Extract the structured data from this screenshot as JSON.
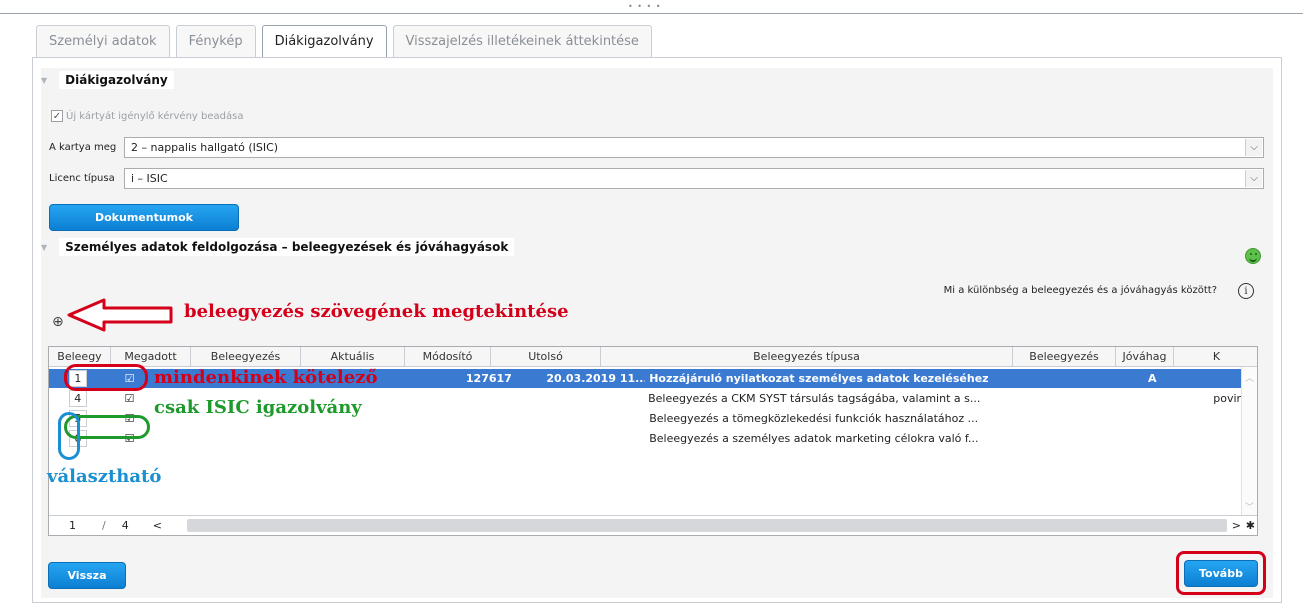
{
  "tabs": [
    {
      "label": "Személyi adatok"
    },
    {
      "label": "Fénykép"
    },
    {
      "label": "Diákigazolvány"
    },
    {
      "label": "Visszajelzés illetékeinek áttekintése"
    }
  ],
  "section1": {
    "title": "Diákigazolvány",
    "checkbox_label": "Új kártyát igénylő kérvény beadása",
    "card_type": {
      "label": "A kartya meg",
      "value": "2 – nappalis hallgató (ISIC)"
    },
    "license_type": {
      "label": "Licenc típusa",
      "value": "i – ISIC"
    },
    "documents_button": "Dokumentumok"
  },
  "section2": {
    "title": "Személyes adatok feldolgozása – beleegyezések és jóváhagyások",
    "help_text": "Mi a különbség a beleegyezés és a jóváhagyás között?",
    "info_icon": "i"
  },
  "annotations": {
    "view_text": "beleegyezés szövegének megtekintése",
    "mandatory": "mindenkinek kötelező",
    "isic_only": "csak ISIC igazolvány",
    "optional": "választható"
  },
  "table": {
    "headers": [
      "Beleegy",
      "Megadott",
      "Beleegyezés",
      "Aktuális",
      "Módosító",
      "Utolsó",
      "Beleegyezés típusa",
      "Beleegyezés",
      "Jóváhag",
      "K"
    ],
    "rows": [
      {
        "num": "1",
        "checked": "☑",
        "modifier": "127617",
        "last": "20.03.2019 11...",
        "type": "Hozzájáruló nyilatkozat személyes adatok kezeléséhez",
        "approval": "A",
        "k": ""
      },
      {
        "num": "4",
        "checked": "☑",
        "modifier": "",
        "last": "",
        "type": "Beleegyezés a CKM SYST társulás tagságába, valamint a s...",
        "approval": "",
        "k": "povir"
      },
      {
        "num": "5",
        "checked": "☑",
        "modifier": "",
        "last": "",
        "type": "Beleegyezés a tömegközlekedési funkciók használatához ...",
        "approval": "",
        "k": ""
      },
      {
        "num": "6",
        "checked": "☑",
        "modifier": "",
        "last": "",
        "type": "Beleegyezés a személyes adatok marketing célokra való f...",
        "approval": "",
        "k": ""
      }
    ],
    "pager": {
      "page": "1",
      "sep": "/",
      "total": "4",
      "prev": "<",
      "next": ">",
      "settings": "✱"
    }
  },
  "footer": {
    "back_button": "Vissza",
    "next_button": "Tovább"
  },
  "colors": {
    "accent": "#0c7fd2",
    "selected_row": "#3a7ad1",
    "annot_red": "#d4001a",
    "annot_green": "#1e9a2c",
    "annot_blue": "#1a8fd1"
  }
}
